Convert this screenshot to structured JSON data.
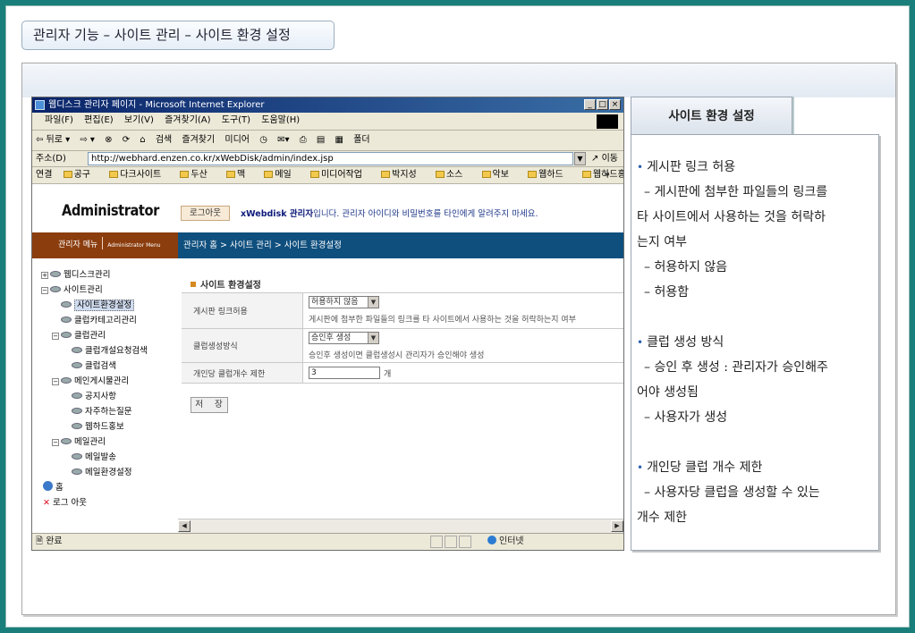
{
  "slide_title": "관리자 기능 – 사이트 관리 – 사이트 환경 설정",
  "browser": {
    "window_title": "웹디스크 관리자 페이지 - Microsoft Internet Explorer",
    "menu": [
      "파일(F)",
      "편집(E)",
      "보기(V)",
      "즐겨찾기(A)",
      "도구(T)",
      "도움말(H)"
    ],
    "toolbar": [
      "⇦ 뒤로 ▾",
      "⇨ ▾",
      "⊗",
      "⟳",
      "⌂",
      "검색",
      "즐겨찾기",
      "미디어",
      "◷",
      "✉▾",
      "⎙",
      "▤",
      "▦",
      "폴더"
    ],
    "address_label": "주소(D)",
    "address_url": "http://webhard.enzen.co.kr/xWebDisk/admin/index.jsp",
    "go_label": "이동",
    "links_label": "연결",
    "links": [
      "공구",
      "다크사이트",
      "두산",
      "맥",
      "메일",
      "미디어작업",
      "박지성",
      "소스",
      "악보",
      "웹하드",
      "웹하드홍보처"
    ],
    "links_more": "»",
    "status_text": "완료",
    "zone_text": "인터넷"
  },
  "admin": {
    "logo_text": "Administrator",
    "menu_header": "관리자 메뉴",
    "menu_header_sub": "Administrator Menu",
    "logout_label": "로그아웃",
    "notice_bold": "xWebdisk 관리자",
    "notice_rest": "입니다. 관리자 아이디와 비밀번호를 타인에게 알려주지 마세요.",
    "breadcrumb": "관리자 홈 > 사이트 관리 > 사이트 환경설정",
    "tree": {
      "webdisk": "웹디스크관리",
      "site": "사이트관리",
      "site_env": "사이트환경설정",
      "club_cat": "클럽카테고리관리",
      "club": "클럽관리",
      "club_req": "클럽개설요청검색",
      "club_search": "클럽검색",
      "main_board": "메인게시물관리",
      "notice": "공지사항",
      "faq": "자주하는질문",
      "promo": "웹하드홍보",
      "mail": "메일관리",
      "mail_send": "메일발송",
      "mail_env": "메일환경설정",
      "home": "홈",
      "logout": "로그 아웃"
    },
    "section_title": "사이트 환경설정",
    "form": {
      "link_label": "게시판 링크허용",
      "link_value": "허용하지 않음",
      "link_hint": "게시판에 첨부한 파일들의 링크를 타 사이트에서 사용하는 것을 허락하는지 여부",
      "club_label": "클럽생성방식",
      "club_value": "승인후 생성",
      "club_hint": "승인후 생성이면 클럽생성시 관리자가 승인해야 생성",
      "limit_label": "개인당 클럽개수 제한",
      "limit_value": "3",
      "limit_unit": "개",
      "save_label": "저 장"
    }
  },
  "panel": {
    "tab_title": "사이트 환경 설정",
    "items": [
      {
        "title": "게시판 링크 허용",
        "lines": [
          "– 게시판에 첨부한 파일들의 링크를",
          "타 사이트에서 사용하는 것을 허락하",
          "는지 여부",
          "– 허용하지 않음",
          "– 허용함"
        ]
      },
      {
        "title": "클럽 생성 방식",
        "lines": [
          "– 승인 후 생성 : 관리자가 승인해주",
          "어야 생성됨",
          "– 사용자가 생성"
        ]
      },
      {
        "title": "개인당 클럽 개수 제한",
        "lines": [
          "– 사용자당 클럽을 생성할 수 있는",
          "개수 제한"
        ]
      }
    ]
  }
}
